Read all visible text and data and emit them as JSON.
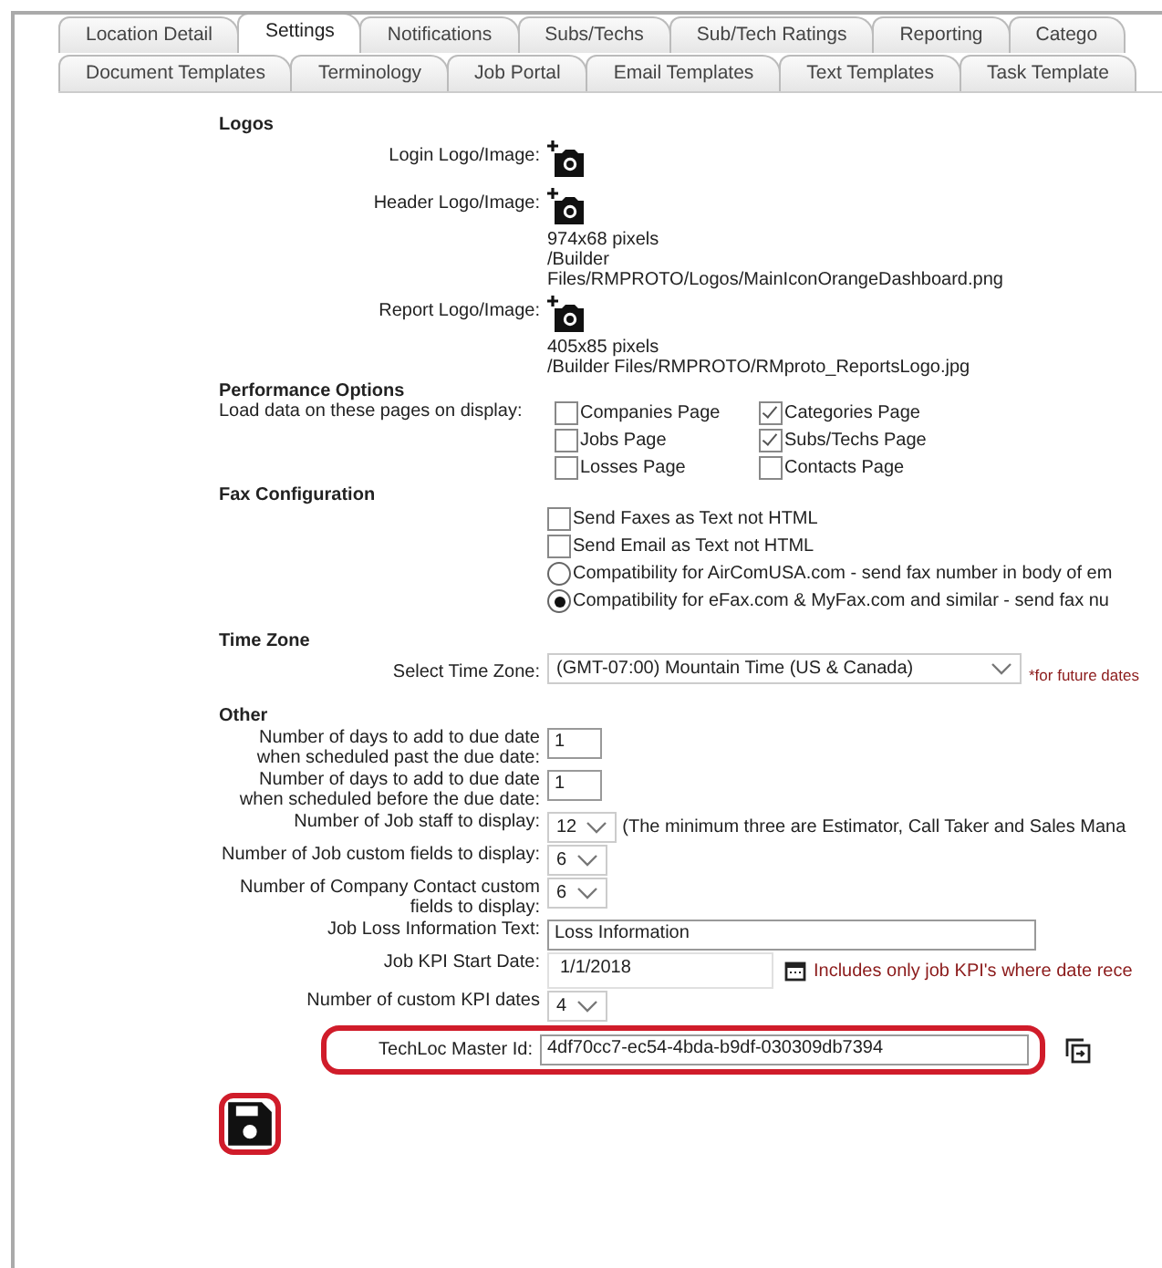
{
  "tabs": {
    "row_1": [
      {
        "label": "Location Detail",
        "selected": false
      },
      {
        "label": "Settings",
        "selected": true
      },
      {
        "label": "Notifications",
        "selected": false
      },
      {
        "label": "Subs/Techs",
        "selected": false
      },
      {
        "label": "Sub/Tech Ratings",
        "selected": false
      },
      {
        "label": "Reporting",
        "selected": false
      },
      {
        "label": "Catego",
        "selected": false
      }
    ],
    "row_2": [
      {
        "label": "Document Templates",
        "selected": false
      },
      {
        "label": "Terminology",
        "selected": false
      },
      {
        "label": "Job Portal",
        "selected": false
      },
      {
        "label": "Email Templates",
        "selected": false
      },
      {
        "label": "Text Templates",
        "selected": false
      },
      {
        "label": "Task Template",
        "selected": false
      }
    ]
  },
  "logos": {
    "heading": "Logos",
    "items": [
      {
        "label": "Login Logo/Image:"
      },
      {
        "label": "Header Logo/Image:",
        "info": [
          "974x68 pixels",
          "/Builder",
          "Files/RMPROTO/Logos/MainIconOrangeDashboard.png"
        ]
      },
      {
        "label": "Report Logo/Image:",
        "info": [
          "405x85 pixels",
          "/Builder Files/RMPROTO/RMproto_ReportsLogo.jpg"
        ]
      }
    ]
  },
  "performance": {
    "heading": "Performance Options",
    "label": "Load data on these pages on display:",
    "options": [
      {
        "label": "Companies Page",
        "checked": false
      },
      {
        "label": "Categories Page",
        "checked": true
      },
      {
        "label": "Jobs Page",
        "checked": false
      },
      {
        "label": "Subs/Techs Page",
        "checked": true
      },
      {
        "label": "Losses Page",
        "checked": false
      },
      {
        "label": "Contacts Page",
        "checked": false
      }
    ]
  },
  "fax": {
    "heading": "Fax Configuration",
    "options": [
      {
        "kind": "checkbox",
        "label": "Send Faxes as Text not HTML",
        "checked": false
      },
      {
        "kind": "checkbox",
        "label": "Send Email as Text not HTML",
        "checked": false
      },
      {
        "kind": "radio",
        "label": "Compatibility for AirComUSA.com - send fax number in body of em",
        "selected": false
      },
      {
        "kind": "radio",
        "label": "Compatibility for eFax.com & MyFax.com and similar - send fax nu",
        "selected": true
      }
    ]
  },
  "time_zone": {
    "heading": "Time Zone",
    "label": "Select Time Zone:",
    "value": "(GMT-07:00) Mountain Time (US & Canada)",
    "note": "*for future dates"
  },
  "other": {
    "heading": "Other",
    "rows": [
      {
        "kind": "number",
        "label": "Number of days to add to due date when scheduled past the due date:",
        "value": "1",
        "highlighted": false
      },
      {
        "kind": "number",
        "label": "Number of days to add to due date when scheduled before the due date:",
        "value": "1",
        "highlighted": false
      },
      {
        "kind": "select",
        "label": "Number of Job staff to display:",
        "value": "12",
        "note": "(The minimum three are Estimator, Call Taker and Sales Mana",
        "highlighted": false
      },
      {
        "kind": "select",
        "label": "Number of Job custom fields to display:",
        "value": "6",
        "highlighted": false
      },
      {
        "kind": "select",
        "label": "Number of Company Contact custom fields to display:",
        "value": "6",
        "highlighted": false
      },
      {
        "kind": "text",
        "label": "Job Loss Information Text:",
        "value": "Loss Information",
        "highlighted": false
      },
      {
        "kind": "date",
        "label": "Job KPI Start Date:",
        "value": "1/1/2018",
        "note": "Includes only job KPI's where date rece",
        "highlighted": false
      },
      {
        "kind": "select",
        "label": "Number of custom KPI dates",
        "value": "4",
        "highlighted": false
      },
      {
        "kind": "id",
        "label": "TechLoc Master Id:",
        "value": "4df70cc7-ec54-4bda-b9df-030309db7394",
        "highlighted": true
      }
    ]
  },
  "save": {
    "highlighted": true
  }
}
